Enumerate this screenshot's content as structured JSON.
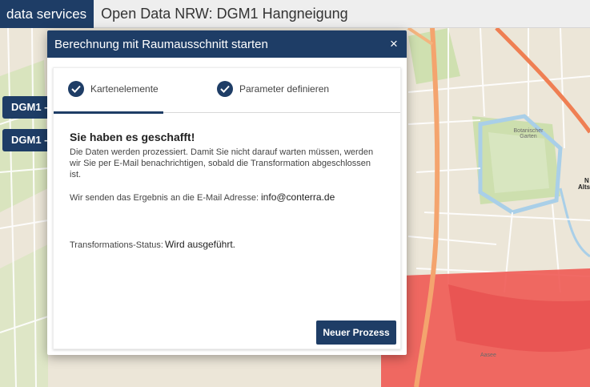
{
  "header": {
    "brand": "data services",
    "app_title": "Open Data NRW: DGM1 Hangneigung"
  },
  "sidebar": {
    "chips": [
      {
        "label": "DGM1 - "
      },
      {
        "label": "DGM1 - "
      }
    ]
  },
  "modal": {
    "title": "Berechnung mit Raumausschnitt starten",
    "close_label": "×",
    "steps": [
      {
        "label": "Kartenelemente",
        "completed": true
      },
      {
        "label": "Parameter definieren",
        "completed": true
      }
    ],
    "success_title": "Sie haben es geschafft!",
    "description": "Die Daten werden prozessiert. Damit Sie nicht darauf warten müssen, werden wir Sie per E-Mail benachrichtigen, sobald die Transformation abgeschlossen ist.",
    "mail_prefix": "Wir senden das Ergebnis an die E-Mail Adresse:",
    "email": "info@conterra.de",
    "status_prefix": "Transformations-Status:",
    "status_value": "Wird ausgeführt.",
    "new_process_label": "Neuer Prozess"
  },
  "map": {
    "labels": {
      "altst": "Altst",
      "n": "N",
      "aasee": "Aasee",
      "garden": "Botanischer Garten"
    },
    "colors": {
      "base": "#ede8dc",
      "selection": "#ef5a54",
      "road_major": "#f08a5b",
      "water": "#a9cfe8"
    }
  },
  "colors": {
    "primary": "#1e3d66"
  }
}
